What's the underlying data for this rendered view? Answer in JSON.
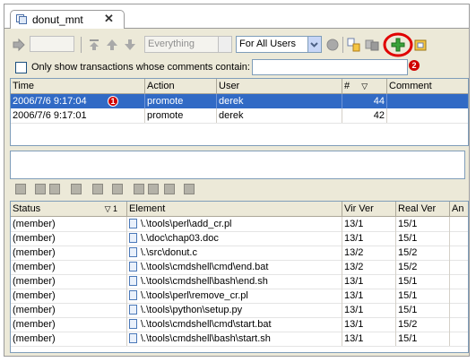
{
  "tab": {
    "label": "donut_mnt",
    "close": "✕"
  },
  "toolbar": {
    "scope_value": "Everything",
    "users_value": "For All Users"
  },
  "filter": {
    "label": "Only show transactions whose comments contain:",
    "value": ""
  },
  "callouts": [
    "1",
    "2"
  ],
  "transactions": {
    "headers": [
      "Time",
      "Action",
      "User",
      "#",
      "Comment"
    ],
    "sort_indicator": "▽",
    "rows": [
      {
        "time": "2006/7/6 9:17:04",
        "action": "promote",
        "user": "derek",
        "num": "44",
        "comment": "",
        "selected": true
      },
      {
        "time": "2006/7/6 9:17:01",
        "action": "promote",
        "user": "derek",
        "num": "42",
        "comment": "",
        "selected": false
      }
    ]
  },
  "elements": {
    "headers": [
      "Status",
      "Element",
      "Vir Ver",
      "Real Ver",
      "An"
    ],
    "status_sort": "▽ 1",
    "rows": [
      {
        "status": "(member)",
        "element": "\\.\\tools\\perl\\add_cr.pl",
        "vir": "13/1",
        "real": "15/1"
      },
      {
        "status": "(member)",
        "element": "\\.\\doc\\chap03.doc",
        "vir": "13/1",
        "real": "15/1"
      },
      {
        "status": "(member)",
        "element": "\\.\\src\\donut.c",
        "vir": "13/2",
        "real": "15/2"
      },
      {
        "status": "(member)",
        "element": "\\.\\tools\\cmdshell\\cmd\\end.bat",
        "vir": "13/2",
        "real": "15/2"
      },
      {
        "status": "(member)",
        "element": "\\.\\tools\\cmdshell\\bash\\end.sh",
        "vir": "13/1",
        "real": "15/1"
      },
      {
        "status": "(member)",
        "element": "\\.\\tools\\perl\\remove_cr.pl",
        "vir": "13/1",
        "real": "15/1"
      },
      {
        "status": "(member)",
        "element": "\\.\\tools\\python\\setup.py",
        "vir": "13/1",
        "real": "15/1"
      },
      {
        "status": "(member)",
        "element": "\\.\\tools\\cmdshell\\cmd\\start.bat",
        "vir": "13/1",
        "real": "15/2"
      },
      {
        "status": "(member)",
        "element": "\\.\\tools\\cmdshell\\bash\\start.sh",
        "vir": "13/1",
        "real": "15/1"
      }
    ]
  },
  "colors": {
    "selection": "#316ac5",
    "callout": "#d00000",
    "highlight_ring": "#e00000"
  }
}
